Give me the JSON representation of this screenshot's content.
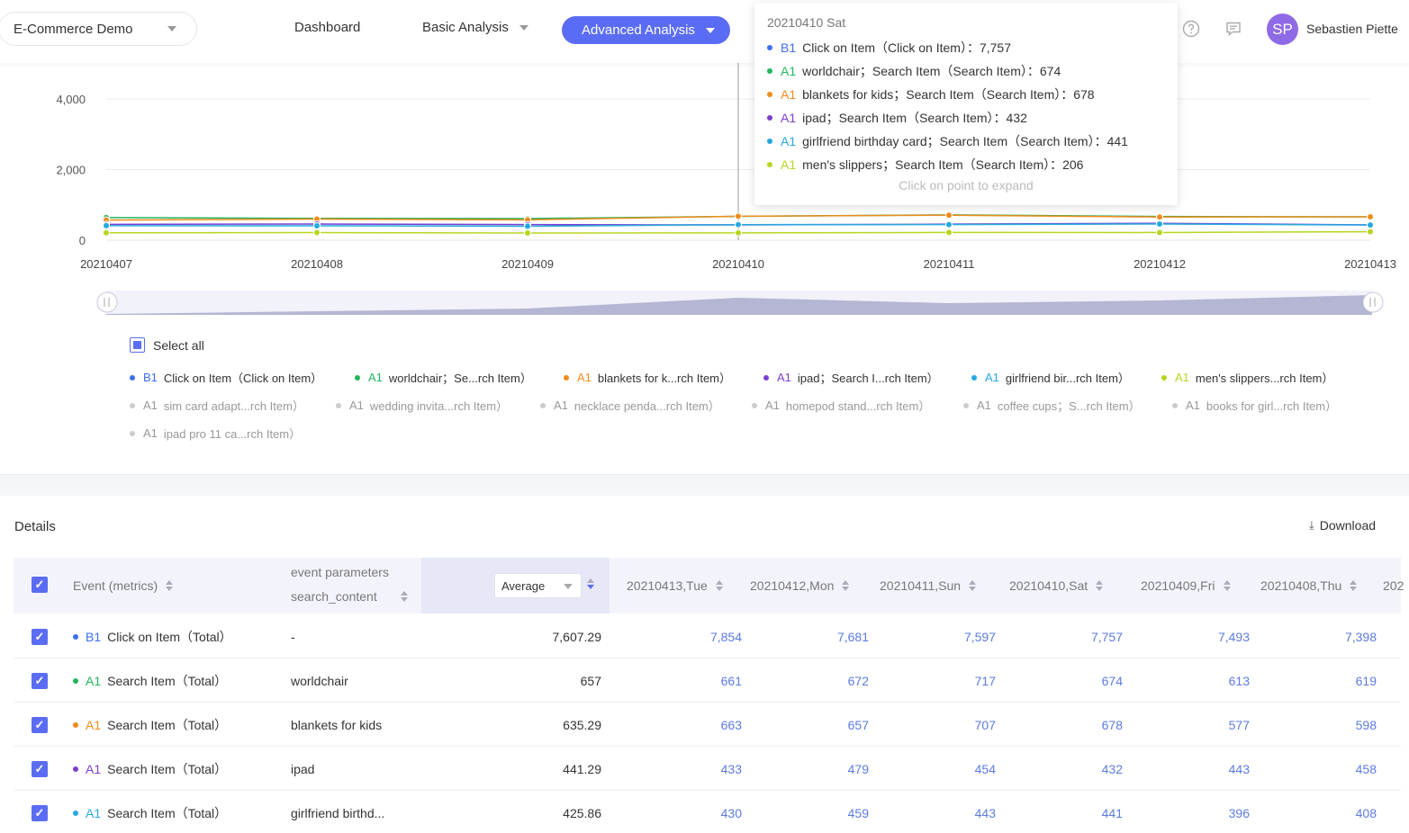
{
  "topbar": {
    "project": "E-Commerce Demo",
    "nav": [
      "Dashboard",
      "Basic Analysis",
      "Advanced Analysis"
    ],
    "username": "Sebastien Piette",
    "avatar_initials": "SP"
  },
  "colors": {
    "accent": "#5b6cf4",
    "series": [
      "#3d6ef0",
      "#21b55c",
      "#f08b1c",
      "#7b3fcf",
      "#25a8e0",
      "#b6d61e"
    ]
  },
  "tooltip": {
    "date": "20210410 Sat",
    "rows": [
      {
        "tag": "B1",
        "text": "Click on Item（Click on Item）：7,757"
      },
      {
        "tag": "A1",
        "text": "worldchair；Search Item（Search Item）：674"
      },
      {
        "tag": "A1",
        "text": "blankets for kids；Search Item（Search Item）：678"
      },
      {
        "tag": "A1",
        "text": "ipad；Search Item（Search Item）：432"
      },
      {
        "tag": "A1",
        "text": "girlfriend birthday card；Search Item（Search Item）：441"
      },
      {
        "tag": "A1",
        "text": "men's slippers；Search Item（Search Item）：206"
      }
    ],
    "hint": "Click on point to expand"
  },
  "chart_data": {
    "type": "line",
    "x": [
      "20210407",
      "20210408",
      "20210409",
      "20210410",
      "20210411",
      "20210412",
      "20210413"
    ],
    "y_ticks": [
      "0",
      "2,000",
      "4,000"
    ],
    "ylim": [
      0,
      4000
    ],
    "series": [
      {
        "name": "worldchair；Search Item（Search Item）",
        "values": [
          640,
          619,
          613,
          674,
          717,
          672,
          661
        ]
      },
      {
        "name": "blankets for kids；Search Item（Search Item）",
        "values": [
          570,
          598,
          577,
          678,
          707,
          657,
          663
        ]
      },
      {
        "name": "ipad；Search Item（Search Item）",
        "values": [
          450,
          458,
          443,
          432,
          454,
          479,
          433
        ]
      },
      {
        "name": "girlfriend birthday card；Search Item（Search Item）",
        "values": [
          410,
          408,
          396,
          441,
          443,
          459,
          430
        ]
      },
      {
        "name": "men's slippers；Search Item（Search Item）",
        "values": [
          210,
          215,
          205,
          206,
          220,
          218,
          240
        ]
      }
    ]
  },
  "legend": {
    "select_all": "Select all",
    "items": [
      {
        "tag": "B1",
        "label": "Click on Item（Click on Item）",
        "on": true
      },
      {
        "tag": "A1",
        "label": "worldchair；Se...rch Item）",
        "on": true
      },
      {
        "tag": "A1",
        "label": "blankets for k...rch Item）",
        "on": true
      },
      {
        "tag": "A1",
        "label": "ipad；Search I...rch Item）",
        "on": true
      },
      {
        "tag": "A1",
        "label": "girlfriend bir...rch Item）",
        "on": true
      },
      {
        "tag": "A1",
        "label": "men's slippers...rch Item）",
        "on": true
      },
      {
        "tag": "A1",
        "label": "sim card adapt...rch Item）",
        "on": false
      },
      {
        "tag": "A1",
        "label": "wedding invita...rch Item）",
        "on": false
      },
      {
        "tag": "A1",
        "label": "necklace penda...rch Item）",
        "on": false
      },
      {
        "tag": "A1",
        "label": "homepod stand...rch Item）",
        "on": false
      },
      {
        "tag": "A1",
        "label": "coffee cups；S...rch Item）",
        "on": false
      },
      {
        "tag": "A1",
        "label": "books for girl...rch Item）",
        "on": false
      },
      {
        "tag": "A1",
        "label": "ipad pro 11 ca...rch Item）",
        "on": false
      }
    ]
  },
  "details": {
    "title": "Details",
    "download": "Download",
    "headers": {
      "event": "Event (metrics)",
      "param_top": "event parameters",
      "param_bottom": "search_content",
      "average": "Average",
      "dates": [
        "20210413,Tue",
        "20210412,Mon",
        "20210411,Sun",
        "20210410,Sat",
        "20210409,Fri",
        "20210408,Thu",
        "202"
      ]
    },
    "rows": [
      {
        "tag": "B1",
        "event": "Click on Item（Total）",
        "param": "-",
        "avg": "7,607.29",
        "values": [
          "7,854",
          "7,681",
          "7,597",
          "7,757",
          "7,493",
          "7,398"
        ]
      },
      {
        "tag": "A1",
        "event": "Search Item（Total）",
        "param": "worldchair",
        "avg": "657",
        "values": [
          "661",
          "672",
          "717",
          "674",
          "613",
          "619"
        ]
      },
      {
        "tag": "A1",
        "event": "Search Item（Total）",
        "param": "blankets for kids",
        "avg": "635.29",
        "values": [
          "663",
          "657",
          "707",
          "678",
          "577",
          "598"
        ]
      },
      {
        "tag": "A1",
        "event": "Search Item（Total）",
        "param": "ipad",
        "avg": "441.29",
        "values": [
          "433",
          "479",
          "454",
          "432",
          "443",
          "458"
        ]
      },
      {
        "tag": "A1",
        "event": "Search Item（Total）",
        "param": "girlfriend birthd...",
        "avg": "425.86",
        "values": [
          "430",
          "459",
          "443",
          "441",
          "396",
          "408"
        ]
      }
    ]
  }
}
